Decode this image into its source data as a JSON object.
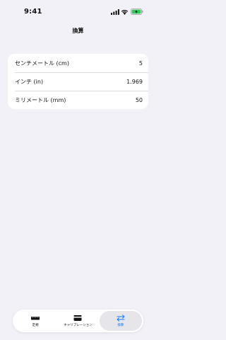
{
  "status_bar": {
    "time": "9:41"
  },
  "nav": {
    "title": "換算"
  },
  "conversions": [
    {
      "label": "センチメートル (cm)",
      "value": "5"
    },
    {
      "label": "インチ (in)",
      "value": "1.969"
    },
    {
      "label": "ミリメートル (mm)",
      "value": "50"
    }
  ],
  "tabs": [
    {
      "label": "定規",
      "icon": "ruler-icon",
      "active": false
    },
    {
      "label": "キャリブレーション",
      "icon": "card-icon",
      "active": false
    },
    {
      "label": "換算",
      "icon": "arrows-swap-icon",
      "active": true
    }
  ],
  "colors": {
    "accent": "#0a7cff",
    "background": "#f2f1f7",
    "battery": "#34c759"
  }
}
